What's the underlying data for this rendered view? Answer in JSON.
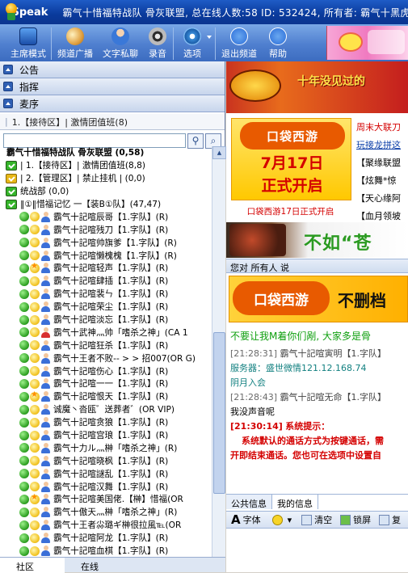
{
  "titlebar": {
    "app": "iSpeak",
    "info": "霸气十惜福特战队  骨灰联盟, 总在线人数:58 ID: 532424, 所有者: 霸气十黑虎"
  },
  "toolbar": {
    "items": [
      {
        "label": "主席模式",
        "color": "#2a5fb8"
      },
      {
        "label": "频道广播",
        "color": "#e0a040"
      },
      {
        "label": "文字私聊",
        "color": "#3a78d8"
      },
      {
        "label": "录音",
        "color": "#2c2c2c"
      },
      {
        "label": "选项",
        "color": "#3a8cd8"
      },
      {
        "label": "退出频道",
        "color": "#2a6cd8"
      },
      {
        "label": "帮助",
        "color": "#2a6cd8"
      }
    ]
  },
  "sections": [
    "公告",
    "指挥",
    "麦序"
  ],
  "current_channel": "1.【接待区】| 激情团值班(8)",
  "tree": {
    "root": "霸气十惜福特战队  骨灰联盟 (0,58)",
    "channels": [
      {
        "text": "| 1.【接待区】| 激情团值班(8,8)",
        "lock": "green"
      },
      {
        "text": "| 2.【管理区】| 禁止挂机 | (0,0)",
        "lock": "yellow"
      },
      {
        "text": "统战部 (0,0)",
        "lock": "green"
      },
      {
        "text": "‖①‖惜福记忆 一【装B①队】(47,47)",
        "lock": "green"
      }
    ],
    "users": [
      {
        "name": "霸气十記喧辰哥【1.字队】(R)",
        "yico": "moon",
        "red": false
      },
      {
        "name": "霸气十記喧残刀【1.字队】(R)",
        "yico": "moon",
        "red": false
      },
      {
        "name": "霸气十記喧帅旗爹【1.字队】(R)",
        "yico": "moon",
        "red": false
      },
      {
        "name": "霸气十記喧懒槐槐【1.字队】(R)",
        "yico": "moon",
        "red": false
      },
      {
        "name": "霸气十記喧轻声【1.字队】(R)",
        "yico": "star",
        "red": false
      },
      {
        "name": "霸气十記喧肆插【1.字队】(R)",
        "yico": "moon",
        "red": false
      },
      {
        "name": "霸气十記喧裴ㄣ【1.字队】(R)",
        "yico": "moon",
        "red": false
      },
      {
        "name": "霸气十記喧荣尘【1.字队】(R)",
        "yico": "moon",
        "red": false
      },
      {
        "name": "霸气十記喧淡忘【1.字队】(R)",
        "yico": "moon",
        "red": false
      },
      {
        "name": "霸气十武神灬帅「嗜杀之神」(CA 1",
        "yico": "moon",
        "red": true
      },
      {
        "name": "霸气十記喧狂杀【1.字队】(R)",
        "yico": "moon",
        "red": false
      },
      {
        "name": "霸气十王者不败-- > > 招007(OR G)",
        "yico": "moon",
        "red": false
      },
      {
        "name": "霸气十記喧伤心【1.字队】(R)",
        "yico": "moon",
        "red": false
      },
      {
        "name": "霸气十記喧一一【1.字队】(R)",
        "yico": "moon",
        "red": false
      },
      {
        "name": "霸气十記喧恨天【1.字队】(R)",
        "yico": "star",
        "red": false
      },
      {
        "name": "诚魔丶沓瓯゛送葬者゛(OR VIP)",
        "yico": "moon",
        "red": false
      },
      {
        "name": "霸气十記喧贪狼【1.字队】(R)",
        "yico": "moon",
        "red": false
      },
      {
        "name": "霸气十記喧宫琅【1.字队】(R)",
        "yico": "moon",
        "red": false
      },
      {
        "name": "霸气十力ル灬榊「嗜杀之神」(R)",
        "yico": "moon",
        "red": false
      },
      {
        "name": "霸气十記喧晓枫【1.字队】(R)",
        "yico": "moon",
        "red": false
      },
      {
        "name": "霸气十記喧謎乱【1.字队】(R)",
        "yico": "moon",
        "red": false
      },
      {
        "name": "霸气十記喧汉舞【1.字队】(R)",
        "yico": "moon",
        "red": false
      },
      {
        "name": "霸气十記喧美国佬.【榊】惜福(OR",
        "yico": "star",
        "red": false
      },
      {
        "name": "霸气十傲天灬榊「嗜杀之神」(R)",
        "yico": "moon",
        "red": false
      },
      {
        "name": "霸气十王者尛璐ギ榊很拉風℡(OR",
        "yico": "moon",
        "red": false
      },
      {
        "name": "霸气十記喧阿龙【1.字队】(R)",
        "yico": "moon",
        "red": false
      },
      {
        "name": "霸气十記喧血棋【1.字队】(R)",
        "yico": "moon",
        "red": false
      }
    ]
  },
  "bottom_tabs": [
    "社区",
    "在线"
  ],
  "right": {
    "banner_top": "十年没见过的",
    "poster": {
      "brand": "口袋西游",
      "date": "7月17日",
      "open": "正式开启",
      "caption": "口袋西游17日正式开启"
    },
    "links": [
      {
        "text": "周末大联刀",
        "style": "red"
      },
      {
        "text": "玩接龙拼这",
        "style": "blue"
      },
      {
        "text": "【聚缘联盟",
        "style": "plain"
      },
      {
        "text": "【炫舞*惊",
        "style": "plain"
      },
      {
        "text": "【天心缘阿",
        "style": "plain"
      },
      {
        "text": "【血月领坡",
        "style": "plain"
      }
    ],
    "banner_mid": "不如“苍",
    "say_bar": "您对 所有人 说",
    "chat_banner": {
      "brand": "口袋西游",
      "text": "不删档"
    },
    "messages": {
      "line1": "不要让我M着你们剐, 大家多是骨",
      "m1_time": "[21:28:31]",
      "m1_name": "霸气十記喧寅明【1.字队】",
      "server": "服务器：盛世微情121.12.168.74",
      "room": "阴月入会",
      "m2_time": "[21:28:43]",
      "m2_name": "霸气十記喧无命【1.字队】",
      "no_voice": "我没声音呢",
      "sys_time": "[21:30:14]",
      "sys_label": "系统提示：",
      "sys_line1": "系统默认的通话方式为按键通话，需",
      "sys_line2": "开即结束通话。您也可在选项中设置自"
    },
    "chat_tabs": [
      "公共信息",
      "我的信息"
    ],
    "format": {
      "font": "字体",
      "clear": "清空",
      "lock": "锁屏",
      "copy": "复"
    }
  }
}
